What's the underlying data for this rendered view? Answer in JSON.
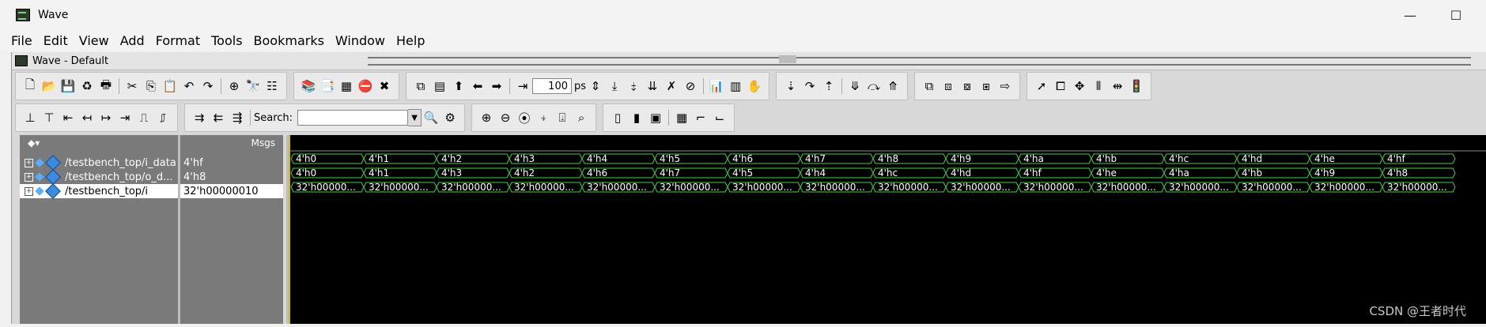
{
  "window": {
    "title": "Wave",
    "minimize": "—",
    "maximize": "☐"
  },
  "menu": [
    "File",
    "Edit",
    "View",
    "Add",
    "Format",
    "Tools",
    "Bookmarks",
    "Window",
    "Help"
  ],
  "subwindow": {
    "title": "Wave - Default"
  },
  "toolbar": {
    "time_value": "100",
    "time_unit": "ps",
    "search_label": "Search:",
    "search_value": ""
  },
  "panes": {
    "values_header": "Msgs"
  },
  "signals": [
    {
      "name": "/testbench_top/i_data",
      "value": "4'hf",
      "selected": false
    },
    {
      "name": "/testbench_top/o_d...",
      "value": "4'h8",
      "selected": false
    },
    {
      "name": "/testbench_top/i",
      "value": "32'h00000010",
      "selected": true
    }
  ],
  "waves": [
    [
      "4'h0",
      "4'h1",
      "4'h2",
      "4'h3",
      "4'h4",
      "4'h5",
      "4'h6",
      "4'h7",
      "4'h8",
      "4'h9",
      "4'ha",
      "4'hb",
      "4'hc",
      "4'hd",
      "4'he",
      "4'hf"
    ],
    [
      "4'h0",
      "4'h1",
      "4'h3",
      "4'h2",
      "4'h6",
      "4'h7",
      "4'h5",
      "4'h4",
      "4'hc",
      "4'hd",
      "4'hf",
      "4'he",
      "4'ha",
      "4'hb",
      "4'h9",
      "4'h8"
    ],
    [
      "32'h00000...",
      "32'h00000...",
      "32'h00000...",
      "32'h00000...",
      "32'h00000...",
      "32'h00000...",
      "32'h00000...",
      "32'h00000...",
      "32'h00000...",
      "32'h00000...",
      "32'h00000...",
      "32'h00000...",
      "32'h00000...",
      "32'h00000...",
      "32'h00000...",
      "32'h00000..."
    ]
  ],
  "watermark": "CSDN @王者时代",
  "colors": {
    "wave_green": "#3cd43c",
    "wave_bg": "#000000",
    "pane_bg": "#7a7a7a"
  }
}
